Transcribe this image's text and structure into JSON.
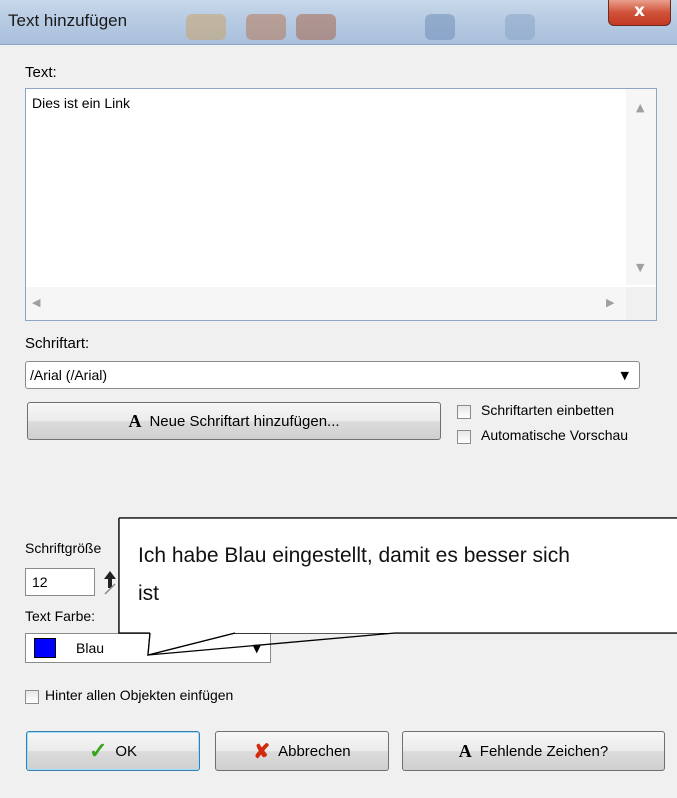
{
  "window": {
    "title": "Text hinzufügen",
    "close_label": "x"
  },
  "text": {
    "label": "Text:",
    "value": "Dies ist ein Link"
  },
  "font": {
    "label": "Schriftart:",
    "selected": "/Arial (/Arial)",
    "add_button_label": "Neue Schriftart hinzufügen...",
    "add_button_glyph": "A",
    "embed_label": "Schriftarten einbetten",
    "preview_label": "Automatische Vorschau"
  },
  "size": {
    "label": "Schriftgröße",
    "value": "12"
  },
  "color": {
    "label": "Text Farbe:",
    "selected": "Blau",
    "swatch_hex": "#0000ff"
  },
  "behind_objects_label": "Hinter allen Objekten einfügen",
  "callout": {
    "line1": "Ich habe Blau eingestellt, damit es besser sich",
    "line2": "ist"
  },
  "buttons": {
    "ok": "OK",
    "cancel": "Abbrechen",
    "missing_chars": "Fehlende Zeichen?",
    "missing_chars_glyph": "A"
  },
  "colors": {
    "accent": "#3c7fb1",
    "titlebar": "#b7cbe3",
    "close": "#c23a22"
  },
  "icons": [
    "close-icon",
    "check-icon",
    "x-icon",
    "font-icon",
    "dropdown-arrow-icon",
    "spin-up-icon"
  ]
}
